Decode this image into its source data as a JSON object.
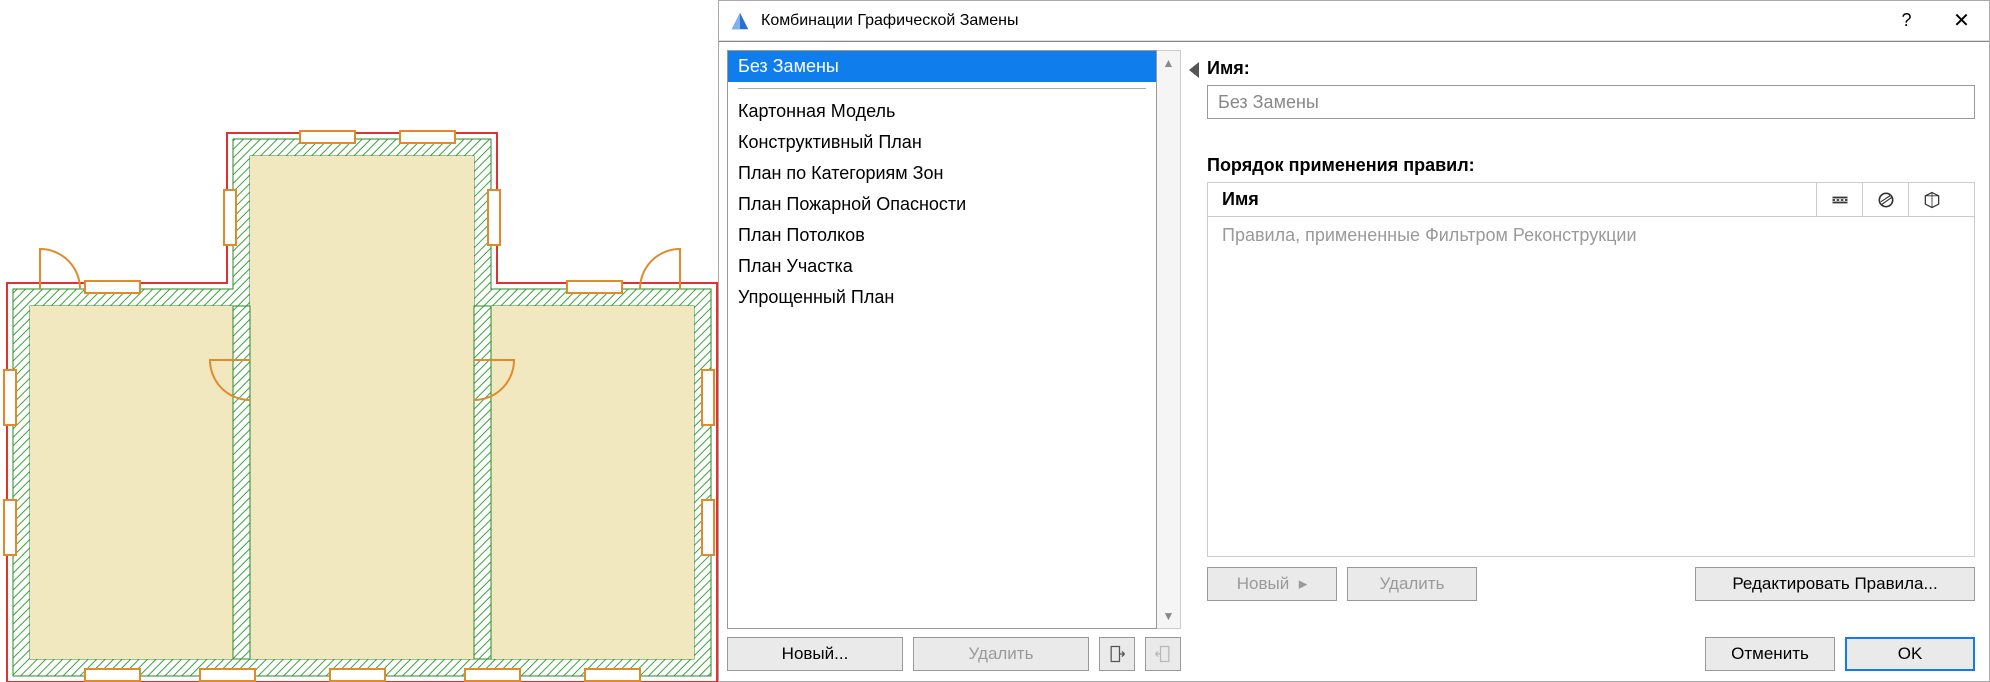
{
  "dialog": {
    "title": "Комбинации Графической Замены",
    "help": "?",
    "close": "✕"
  },
  "list": {
    "selected": "Без Замены",
    "items": [
      "Картонная Модель",
      "Конструктивный План",
      "План по Категориям Зон",
      "План Пожарной Опасности",
      "План Потолков",
      "План Участка",
      "Упрощенный План"
    ]
  },
  "left_buttons": {
    "new": "Новый...",
    "delete": "Удалить"
  },
  "right": {
    "name_label": "Имя:",
    "name_value": "Без Замены",
    "rules_label": "Порядок применения правил:",
    "rules_col_name": "Имя",
    "rules_placeholder": "Правила, примененные Фильтром Реконструкции"
  },
  "rules_buttons": {
    "new": "Новый",
    "delete": "Удалить",
    "edit": "Редактировать Правила..."
  },
  "footer": {
    "cancel": "Отменить",
    "ok": "OK"
  },
  "icons": {
    "import": "import-icon",
    "export": "export-icon",
    "line_style": "line-style-icon",
    "fill_style": "fill-style-icon",
    "surface": "surface-icon"
  }
}
